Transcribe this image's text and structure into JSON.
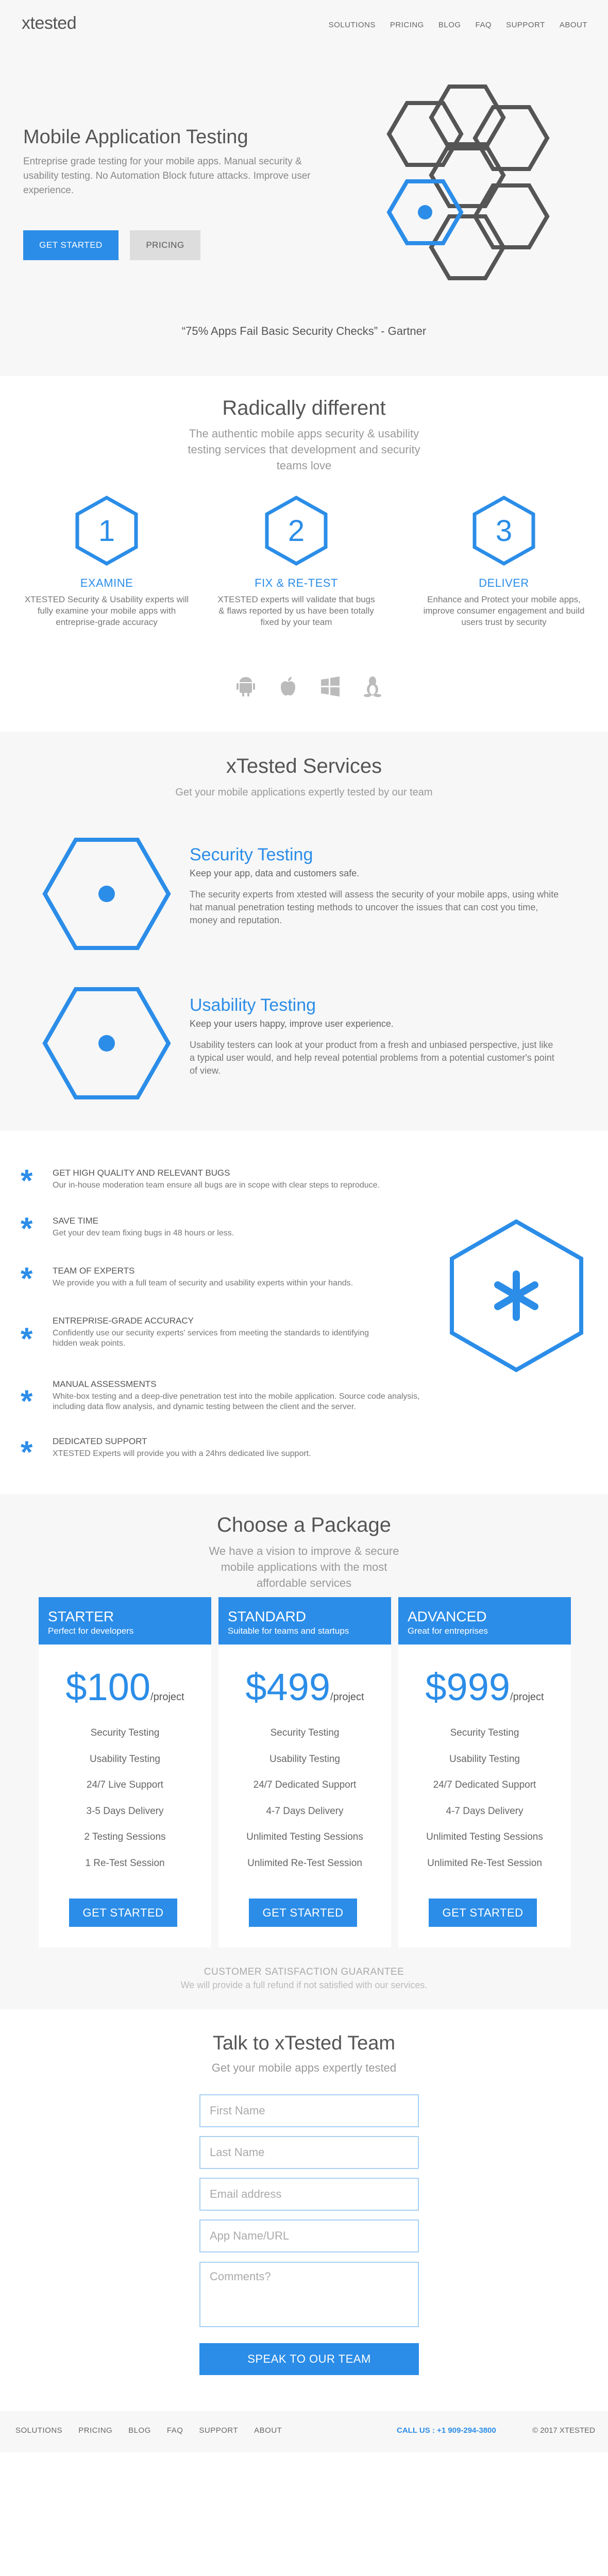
{
  "nav": {
    "logo": "xtested",
    "items": [
      "SOLUTIONS",
      "PRICING",
      "BLOG",
      "FAQ",
      "SUPPORT",
      "ABOUT"
    ]
  },
  "hero": {
    "title": "Mobile Application Testing",
    "subtitle": "Entreprise grade testing for your mobile apps. Manual security & usability testing. No Automation Block future attacks. Improve user experience.",
    "cta_primary": "GET STARTED",
    "cta_secondary": "PRICING",
    "quote": "“75% Apps Fail Basic Security Checks” - Gartner"
  },
  "different": {
    "title": "Radically different",
    "subtitle": "The authentic mobile apps security & usability testing services that development and security teams love",
    "steps": [
      {
        "number": "1",
        "title": "EXAMINE",
        "desc": "XTESTED Security & Usability experts will fully examine your mobile apps with entreprise-grade accuracy"
      },
      {
        "number": "2",
        "title": "FIX & RE-TEST",
        "desc": "XTESTED experts will validate that bugs & flaws reported by us have been totally fixed by your team"
      },
      {
        "number": "3",
        "title": "DELIVER",
        "desc": "Enhance and Protect your mobile apps, improve consumer engagement and build users trust by security"
      }
    ],
    "platforms": [
      "android-icon",
      "apple-icon",
      "windows-icon",
      "linux-icon"
    ]
  },
  "services": {
    "title": "xTested Services",
    "subtitle": "Get your mobile applications expertly tested by our team",
    "items": [
      {
        "title": "Security Testing",
        "tagline": "Keep your app, data and customers safe.",
        "desc": "The security experts from xtested will assess the security of your mobile apps, using white hat manual penetration testing methods to uncover the issues that can cost you time, money and reputation."
      },
      {
        "title": "Usability Testing",
        "tagline": "Keep your users happy, improve user experience.",
        "desc": "Usability testers can look at your product from a fresh and unbiased perspective, just like a typical user would, and help reveal potential problems from a potential customer's point of view."
      }
    ]
  },
  "features": [
    {
      "title": "GET HIGH QUALITY AND RELEVANT BUGS",
      "desc": "Our in-house moderation team ensure all bugs are in scope with clear steps to reproduce."
    },
    {
      "title": "SAVE TIME",
      "desc": "Get your dev team fixing bugs in 48 hours or less."
    },
    {
      "title": "TEAM OF EXPERTS",
      "desc": "We provide you with a full team of security and usability experts within your hands."
    },
    {
      "title": "ENTREPRISE-GRADE ACCURACY",
      "desc": "Confidently use our security experts' services from meeting the standards to identifying hidden weak points."
    },
    {
      "title": "MANUAL ASSESSMENTS",
      "desc": "White-box testing and a deep-dive penetration test into the mobile application. Source code analysis, including data flow analysis, and dynamic testing between the client and the server."
    },
    {
      "title": "DEDICATED SUPPORT",
      "desc": "XTESTED Experts will provide you with a 24hrs dedicated live support."
    }
  ],
  "pricing": {
    "title": "Choose a Package",
    "subtitle": "We have a vision to improve & secure mobile applications with the most affordable services",
    "plans": [
      {
        "name": "STARTER",
        "tagline": "Perfect for developers",
        "price": "$100",
        "per": "/project",
        "features": [
          "Security Testing",
          "Usability Testing",
          "24/7 Live Support",
          "3-5 Days Delivery",
          "2 Testing Sessions",
          "1 Re-Test Session"
        ],
        "cta": "GET STARTED"
      },
      {
        "name": "STANDARD",
        "tagline": "Suitable for teams and startups",
        "price": "$499",
        "per": "/project",
        "features": [
          "Security Testing",
          "Usability Testing",
          "24/7 Dedicated Support",
          "4-7 Days Delivery",
          "Unlimited Testing Sessions",
          "Unlimited Re-Test Session"
        ],
        "cta": "GET STARTED"
      },
      {
        "name": "ADVANCED",
        "tagline": "Great for entreprises",
        "price": "$999",
        "per": "/project",
        "features": [
          "Security Testing",
          "Usability Testing",
          "24/7 Dedicated Support",
          "4-7 Days Delivery",
          "Unlimited Testing Sessions",
          "Unlimited Re-Test Session"
        ],
        "cta": "GET STARTED"
      }
    ],
    "guarantee_title": "CUSTOMER SATISFACTION GUARANTEE",
    "guarantee_desc": "We will provide a full refund if not satisfied with our services."
  },
  "contact": {
    "title": "Talk to xTested Team",
    "subtitle": "Get your mobile apps expertly tested",
    "fields": {
      "first": "First Name",
      "last": "Last Name",
      "email": "Email address",
      "app": "App Name/URL",
      "comments": "Comments?"
    },
    "submit": "SPEAK TO OUR TEAM"
  },
  "footer": {
    "items": [
      "SOLUTIONS",
      "PRICING",
      "BLOG",
      "FAQ",
      "SUPPORT",
      "ABOUT"
    ],
    "call": "CALL US : +1 909-294-3800",
    "copyright": "© 2017 XTESTED"
  },
  "colors": {
    "accent": "#2b8de8",
    "dark_hex": "#555555",
    "background": "#f7f7f7"
  }
}
